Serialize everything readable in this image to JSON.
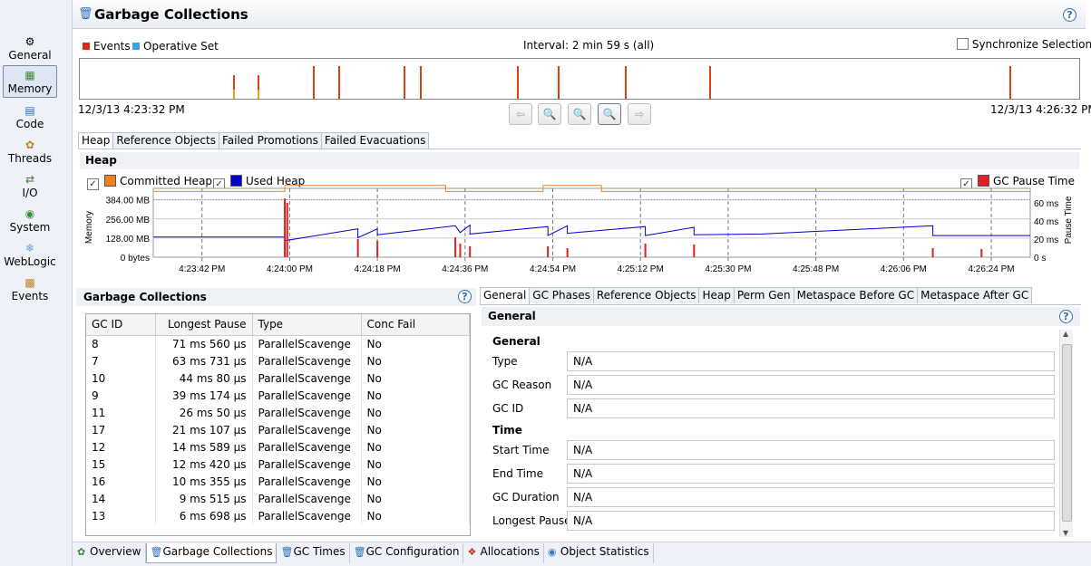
{
  "nav": {
    "items": [
      {
        "label": "General",
        "icon": "general-icon"
      },
      {
        "label": "Memory",
        "icon": "memory-icon",
        "active": true
      },
      {
        "label": "Code",
        "icon": "code-icon"
      },
      {
        "label": "Threads",
        "icon": "threads-icon"
      },
      {
        "label": "I/O",
        "icon": "io-icon"
      },
      {
        "label": "System",
        "icon": "system-icon"
      },
      {
        "label": "WebLogic",
        "icon": "weblogic-icon"
      },
      {
        "label": "Events",
        "icon": "events-icon"
      }
    ]
  },
  "page": {
    "title": "Garbage Collections",
    "help": "?"
  },
  "timeline": {
    "legend_events": "Events",
    "legend_operative": "Operative Set",
    "interval": "Interval: 2 min 59 s (all)",
    "sync_label": "Synchronize Selection",
    "start_time": "12/3/13 4:23:32 PM",
    "end_time": "12/3/13 4:26:32 PM",
    "event_fractions": [
      0.153,
      0.178,
      0.233,
      0.259,
      0.324,
      0.34,
      0.437,
      0.478,
      0.545,
      0.63,
      0.93
    ],
    "colors": {
      "events": "#e04010",
      "operative": "#40a0e0"
    }
  },
  "upper_tabs": [
    "Heap",
    "Reference Objects",
    "Failed Promotions",
    "Failed Evacuations"
  ],
  "heap": {
    "section_title": "Heap",
    "committed_label": "Committed Heap",
    "used_label": "Used Heap",
    "pause_label": "GC Pause Time",
    "colors": {
      "committed": "#f08020",
      "used": "#0000d0",
      "pause": "#e02020"
    }
  },
  "chart_data": {
    "type": "line",
    "ylabel": "Memory",
    "y2label": "Pause Time",
    "y_ticks": [
      "0 bytes",
      "128.00 MB",
      "256.00 MB",
      "384.00 MB"
    ],
    "y2_ticks": [
      "0 s",
      "20 ms",
      "40 ms",
      "60 ms"
    ],
    "x_ticks": [
      "4:23:42 PM",
      "4:24:00 PM",
      "4:24:18 PM",
      "4:24:36 PM",
      "4:24:54 PM",
      "4:25:12 PM",
      "4:25:30 PM",
      "4:25:48 PM",
      "4:26:06 PM",
      "4:26:24 PM"
    ],
    "ylim": [
      0,
      400
    ],
    "y2lim": [
      0,
      66
    ],
    "xlim": [
      0,
      180
    ],
    "series": [
      {
        "name": "Committed Heap",
        "points": [
          [
            0,
            440
          ],
          [
            27,
            440
          ],
          [
            27,
            480
          ],
          [
            60,
            480
          ],
          [
            60,
            440
          ],
          [
            80,
            440
          ],
          [
            80,
            480
          ],
          [
            92,
            480
          ],
          [
            92,
            440
          ],
          [
            180,
            440
          ]
        ]
      },
      {
        "name": "Used Heap",
        "points": [
          [
            0,
            135
          ],
          [
            27,
            135
          ],
          [
            27,
            110
          ],
          [
            42,
            190
          ],
          [
            42,
            130
          ],
          [
            46,
            190
          ],
          [
            46,
            150
          ],
          [
            62,
            210
          ],
          [
            63,
            165
          ],
          [
            65,
            215
          ],
          [
            65,
            155
          ],
          [
            81,
            205
          ],
          [
            81,
            145
          ],
          [
            85,
            210
          ],
          [
            85,
            160
          ],
          [
            101,
            205
          ],
          [
            101,
            145
          ],
          [
            111,
            200
          ],
          [
            111,
            150
          ],
          [
            125,
            155
          ],
          [
            160,
            210
          ],
          [
            160,
            145
          ],
          [
            180,
            145
          ]
        ]
      }
    ],
    "pause_events": [
      [
        27,
        65
      ],
      [
        27.5,
        60
      ],
      [
        42,
        20
      ],
      [
        46,
        18
      ],
      [
        62,
        22
      ],
      [
        63,
        15
      ],
      [
        65,
        12
      ],
      [
        81,
        12
      ],
      [
        85,
        10
      ],
      [
        101,
        15
      ],
      [
        111,
        14
      ],
      [
        160,
        10
      ],
      [
        170,
        9
      ]
    ]
  },
  "gc_table": {
    "title": "Garbage Collections",
    "columns": [
      "GC ID",
      "Longest Pause",
      "Type",
      "Conc Fail"
    ],
    "rows": [
      [
        "8",
        "71 ms 560 µs",
        "ParallelScavenge",
        "No"
      ],
      [
        "7",
        "63 ms 731 µs",
        "ParallelScavenge",
        "No"
      ],
      [
        "10",
        "44 ms 80 µs",
        "ParallelScavenge",
        "No"
      ],
      [
        "9",
        "39 ms 174 µs",
        "ParallelScavenge",
        "No"
      ],
      [
        "11",
        "26 ms 50 µs",
        "ParallelScavenge",
        "No"
      ],
      [
        "17",
        "21 ms 107 µs",
        "ParallelScavenge",
        "No"
      ],
      [
        "12",
        "14 ms 589 µs",
        "ParallelScavenge",
        "No"
      ],
      [
        "15",
        "12 ms 420 µs",
        "ParallelScavenge",
        "No"
      ],
      [
        "16",
        "10 ms 355 µs",
        "ParallelScavenge",
        "No"
      ],
      [
        "14",
        "9 ms 515 µs",
        "ParallelScavenge",
        "No"
      ],
      [
        "13",
        "6 ms 698 µs",
        "ParallelScavenge",
        "No"
      ]
    ]
  },
  "detail_tabs": [
    "General",
    "GC Phases",
    "Reference Objects",
    "Heap",
    "Perm Gen",
    "Metaspace Before GC",
    "Metaspace After GC"
  ],
  "detail": {
    "panel_title": "General",
    "group_general": "General",
    "group_time": "Time",
    "fields": [
      {
        "label": "Type",
        "value": "N/A"
      },
      {
        "label": "GC Reason",
        "value": "N/A"
      },
      {
        "label": "GC ID",
        "value": "N/A"
      },
      {
        "label": "Start Time",
        "value": "N/A"
      },
      {
        "label": "End Time",
        "value": "N/A"
      },
      {
        "label": "GC Duration",
        "value": "N/A"
      },
      {
        "label": "Longest Pause",
        "value": "N/A"
      }
    ]
  },
  "bottom_tabs": [
    {
      "label": "Overview",
      "icon": "overview-icon"
    },
    {
      "label": "Garbage Collections",
      "icon": "trash-icon",
      "active": true
    },
    {
      "label": "GC Times",
      "icon": "gc-times-icon"
    },
    {
      "label": "GC Configuration",
      "icon": "gc-config-icon"
    },
    {
      "label": "Allocations",
      "icon": "allocations-icon"
    },
    {
      "label": "Object Statistics",
      "icon": "object-stats-icon"
    }
  ]
}
